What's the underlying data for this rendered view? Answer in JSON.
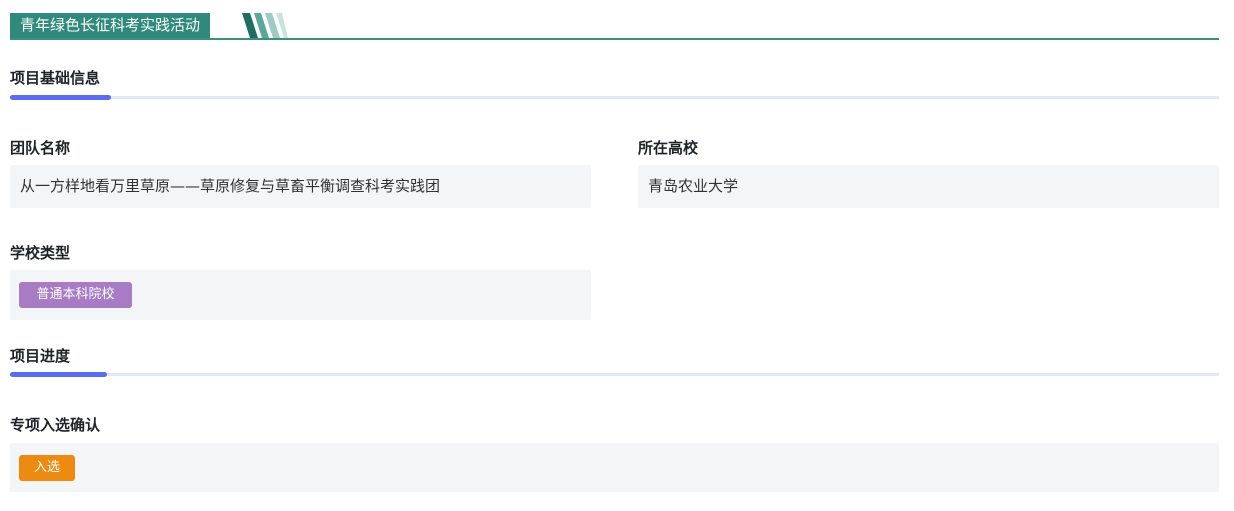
{
  "banner": {
    "title": "青年绿色长征科考实践活动",
    "color": "#2f8a7c"
  },
  "sections": {
    "basic": {
      "title": "项目基础信息"
    },
    "progress": {
      "title": "项目进度"
    }
  },
  "fields": {
    "team_name": {
      "label": "团队名称",
      "value": "从一方样地看万里草原——草原修复与草畜平衡调查科考实践团"
    },
    "university": {
      "label": "所在高校",
      "value": "青岛农业大学"
    },
    "school_type": {
      "label": "学校类型",
      "tag": "普通本科院校",
      "tag_color": "#a87cc4"
    },
    "selection": {
      "label": "专项入选确认",
      "tag": "入选",
      "tag_color": "#ec8a12"
    }
  },
  "accent_color": "#5b6cf0"
}
